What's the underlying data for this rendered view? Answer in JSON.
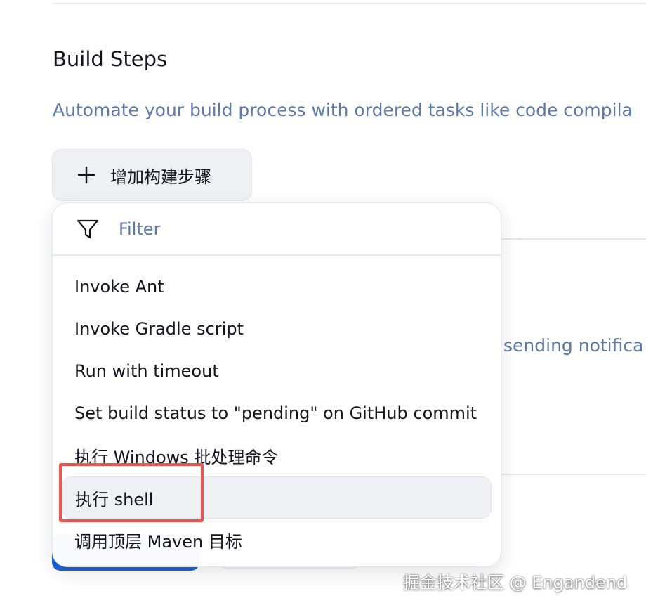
{
  "section": {
    "title": "Build Steps",
    "description": "Automate your build process with ordered tasks like code compila"
  },
  "add_step_button": {
    "label": "增加构建步骤",
    "icon": "plus-icon"
  },
  "background": {
    "partial_text": "sending notifica"
  },
  "dropdown": {
    "filter": {
      "placeholder": "Filter",
      "value": "",
      "icon": "filter-icon"
    },
    "items": [
      {
        "label": "Invoke Ant"
      },
      {
        "label": "Invoke Gradle script"
      },
      {
        "label": "Run with timeout"
      },
      {
        "label": "Set build status to \"pending\" on GitHub commit"
      },
      {
        "label": "执行 Windows 批处理命令"
      },
      {
        "label": "执行 shell",
        "active": true
      },
      {
        "label": "调用顶层 Maven 目标"
      }
    ]
  },
  "annotation": {
    "highlight_color": "#ef5350"
  },
  "watermark": {
    "text": "掘金技术社区 @ Engandend"
  },
  "colors": {
    "link_text": "#5b7aa8",
    "primary_button": "#1d5fd7",
    "hover_item": "#eef0f4"
  }
}
